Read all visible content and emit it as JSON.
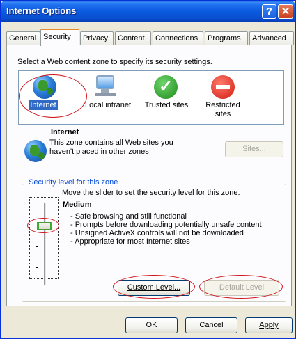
{
  "window": {
    "title": "Internet Options"
  },
  "tabs": [
    "General",
    "Security",
    "Privacy",
    "Content",
    "Connections",
    "Programs",
    "Advanced"
  ],
  "instruction": "Select a Web content zone to specify its security settings.",
  "zones": [
    {
      "label": "Internet",
      "icon": "globe-icon"
    },
    {
      "label": "Local intranet",
      "icon": "monitor-icon"
    },
    {
      "label": "Trusted sites",
      "icon": "checkmark-icon"
    },
    {
      "label": "Restricted sites",
      "icon": "no-entry-icon"
    }
  ],
  "selected_zone": {
    "name": "Internet",
    "description": "This zone contains all Web sites you haven't placed in other zones",
    "sites_button": "Sites..."
  },
  "security": {
    "group_label": "Security level for this zone",
    "instruction": "Move the slider to set the security level for this zone.",
    "level": "Medium",
    "bullets": [
      "- Safe browsing and still functional",
      "- Prompts before downloading potentially unsafe content",
      "- Unsigned ActiveX controls will not be downloaded",
      "- Appropriate for most Internet sites"
    ],
    "custom_button": "Custom Level...",
    "default_button": "Default Level"
  },
  "footer": {
    "ok": "OK",
    "cancel": "Cancel",
    "apply": "Apply"
  },
  "colors": {
    "titlebar": "#0a58dc",
    "annotation": "#d0141a",
    "selection": "#316ac5",
    "group_title": "#0046d5"
  }
}
